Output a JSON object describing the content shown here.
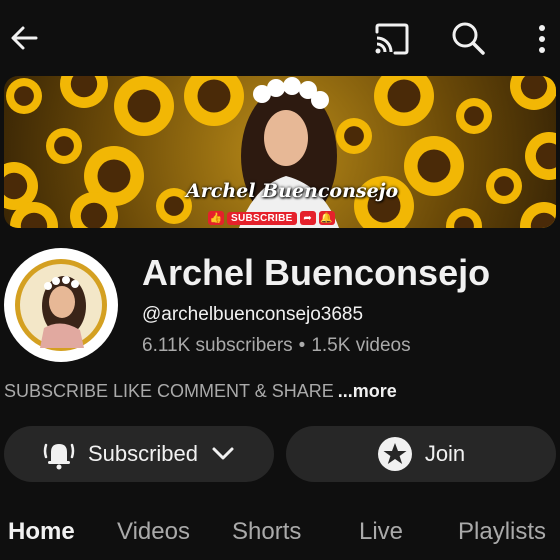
{
  "topbar": {
    "back_icon": "arrow-left-icon",
    "cast_icon": "cast-icon",
    "search_icon": "search-icon",
    "more_icon": "more-vertical-icon"
  },
  "banner": {
    "name_text": "Archel Buenconsejo",
    "subscribe_text": "SUBSCRIBE"
  },
  "channel": {
    "name": "Archel Buenconsejo",
    "handle": "@archelbuenconsejo3685",
    "subscribers": "6.11K subscribers",
    "separator": "•",
    "videos": "1.5K videos"
  },
  "description": {
    "text": "SUBSCRIBE LIKE COMMENT & SHARE",
    "more_label": "...more"
  },
  "actions": {
    "subscribed_label": "Subscribed",
    "join_label": "Join"
  },
  "tabs": [
    {
      "label": "Home",
      "active": true
    },
    {
      "label": "Videos"
    },
    {
      "label": "Shorts"
    },
    {
      "label": "Live"
    },
    {
      "label": "Playlists"
    }
  ],
  "colors": {
    "background": "#0f0f0f",
    "pill": "#272727",
    "secondary_text": "#aaaaaa",
    "subscribe_red": "#e5212b"
  }
}
